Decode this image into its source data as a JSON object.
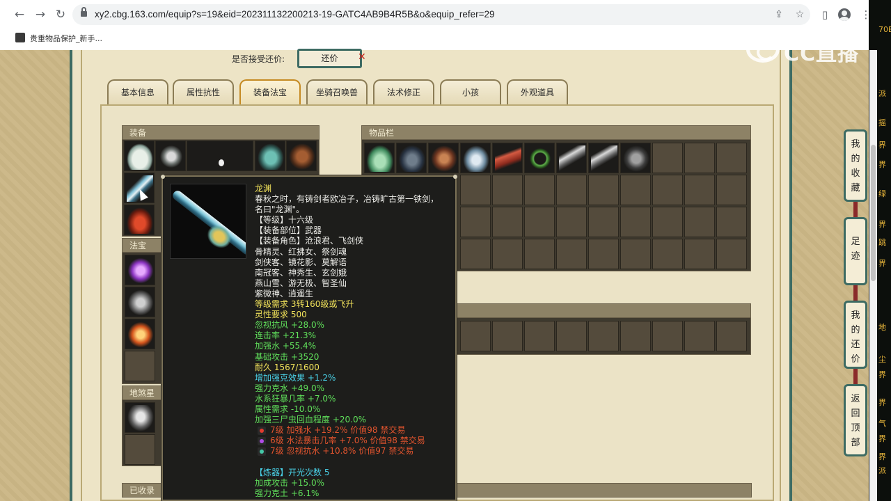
{
  "browser": {
    "url": "xy2.cbg.163.com/equip?s=19&eid=202311132200213-19-GATC4AB9B4R5B&o&equip_refer=29",
    "bookmark_label": "贵重物品保护_新手..."
  },
  "offer": {
    "label": "是否接受还价:",
    "button_label": "还价"
  },
  "tabs": [
    {
      "label": "基本信息"
    },
    {
      "label": "属性抗性"
    },
    {
      "label": "装备法宝",
      "active": true
    },
    {
      "label": "坐骑召唤兽"
    },
    {
      "label": "法术修正"
    },
    {
      "label": "小孩"
    },
    {
      "label": "外观道具"
    }
  ],
  "panels": {
    "equipment_title": "装备",
    "inventory_title": "物品栏",
    "treasure_title": "法宝",
    "earth_title": "地煞星",
    "collected_title": "已收录"
  },
  "tooltip": {
    "name": "龙渊",
    "desc1": "春秋之时，有铸剑者欧冶子，冶铸旷古第一铁剑，",
    "desc2": "名曰\"龙渊\"。",
    "level": "【等级】十六级",
    "slot": "【装备部位】武器",
    "roles1": "【装备角色】沧浪君、飞剑侠",
    "roles2": "骨精灵、红拂女、祭剑魂",
    "roles3": "剑侠客、镜花影、莫解语",
    "roles4": "南冠客、神秀生、玄剑娥",
    "roles5": "燕山雪、游无极、智圣仙",
    "roles6": "紫微神、逍遥生",
    "req_level": "等级需求 3转160级或飞升",
    "req_spirit": "灵性要求 500",
    "stat1": "忽视抗风 +28.0%",
    "stat2": "连击率 +21.3%",
    "stat3": "加强水 +55.4%",
    "stat4": "基础攻击 +3520",
    "durability": "耐久 1567/1600",
    "stat5": "增加强克效果 +1.2%",
    "stat6": "强力克水 +49.0%",
    "stat7": "水系狂暴几率 +7.0%",
    "stat8": "属性需求 -10.0%",
    "stat9": "加强三尸虫回血程度 +20.0%",
    "gem1": "7级 加强水 +19.2% 价值98 禁交易",
    "gem2": "6级 水法暴击几率 +7.0% 价值98 禁交易",
    "gem3": "7级 忽视抗水 +10.8% 价值97 禁交易",
    "refine": "【炼器】开光次数 5",
    "refine1": "加成攻击 +15.0%",
    "refine2": "强力克土 +6.1%"
  },
  "sidenav": [
    {
      "label": "我\n的\n收\n藏"
    },
    {
      "label": "足\n迹"
    },
    {
      "label": "我\n的\n还\n价"
    },
    {
      "label": "返\n回\n顶\n部"
    }
  ],
  "watermark": "CC直播",
  "strip_texts": [
    "70E",
    "派",
    "摇",
    "界",
    "界",
    "绿",
    "界",
    "跳",
    "界",
    "地",
    "尘",
    "界",
    "界",
    "气",
    "界",
    "界",
    "派"
  ],
  "icons": [
    "back-arrow-icon",
    "forward-arrow-icon",
    "reload-icon",
    "lock-icon",
    "share-icon",
    "star-icon",
    "sidebar-icon",
    "profile-icon",
    "menu-icon"
  ],
  "colors": {
    "frame_teal": "#3d6b63",
    "tooltip_yellow": "#f2e35b",
    "tooltip_green": "#60e05b",
    "tooltip_cyan": "#4ad2e8",
    "tooltip_orange": "#e2542e"
  }
}
